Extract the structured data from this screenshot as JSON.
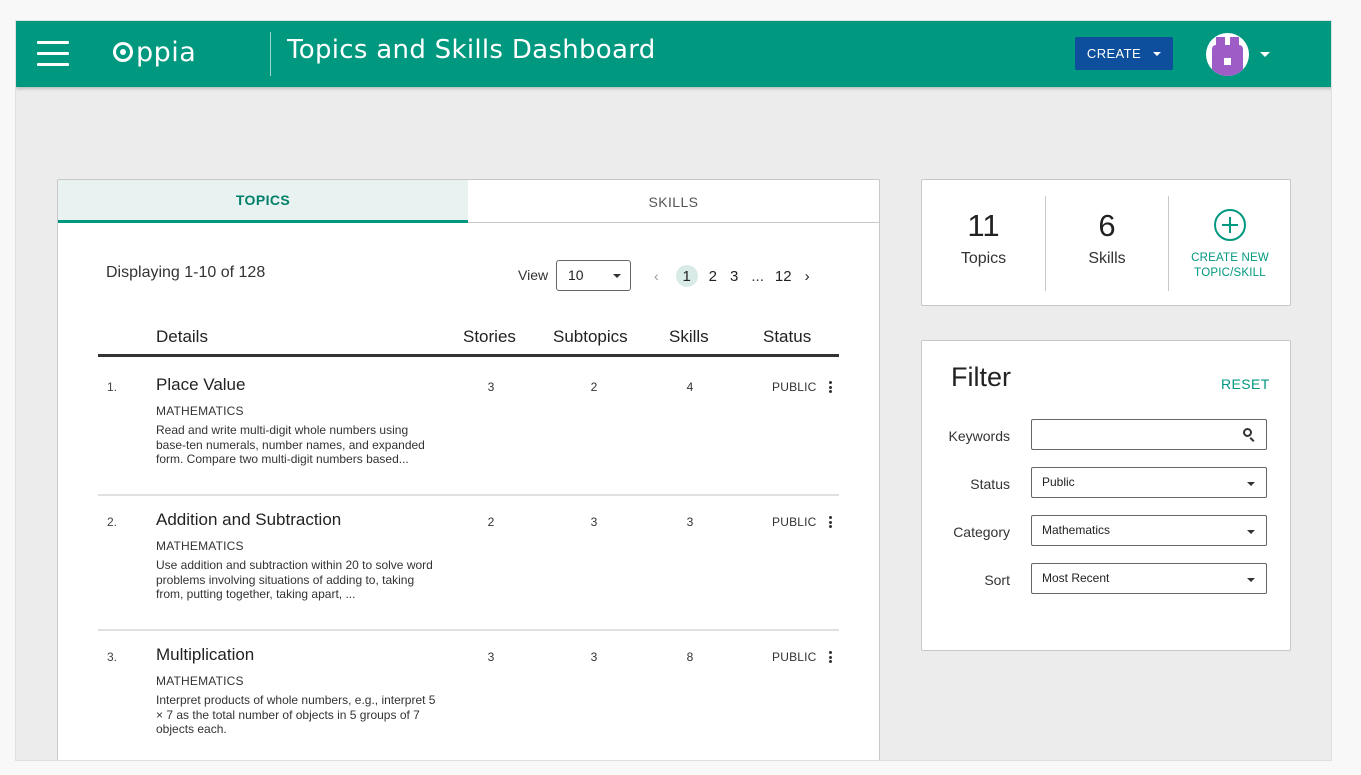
{
  "navbar": {
    "logo_text": "ppia",
    "title": "Topics and Skills Dashboard",
    "create_label": "CREATE",
    "color": "#00987f",
    "create_color": "#0d4f9c"
  },
  "tabs": [
    {
      "label": "TOPICS",
      "active": true
    },
    {
      "label": "SKILLS",
      "active": false
    }
  ],
  "listing": {
    "displaying": "Displaying 1-10 of 128",
    "view_label": "View",
    "view_value": "10",
    "pagination": {
      "prev": "‹",
      "pages": [
        "1",
        "2",
        "3"
      ],
      "ellipsis": "...",
      "last": "12",
      "next": "›",
      "current": "1"
    }
  },
  "table": {
    "headers": {
      "details": "Details",
      "stories": "Stories",
      "subtopics": "Subtopics",
      "skills": "Skills",
      "status": "Status"
    },
    "rows": [
      {
        "num": "1.",
        "name": "Place Value",
        "category": "MATHEMATICS",
        "description": "Read and write multi-digit whole numbers using base-ten numerals, number names, and expanded form. Compare two multi-digit numbers based...",
        "stories": "3",
        "subtopics": "2",
        "skills": "4",
        "status": "PUBLIC"
      },
      {
        "num": "2.",
        "name": "Addition and Subtraction",
        "category": "MATHEMATICS",
        "description": "Use addition and subtraction within 20 to solve word problems involving situations of adding to, taking from, putting together, taking apart, ...",
        "stories": "2",
        "subtopics": "3",
        "skills": "3",
        "status": "PUBLIC"
      },
      {
        "num": "3.",
        "name": "Multiplication",
        "category": "MATHEMATICS",
        "description": "Interpret products of whole numbers, e.g., interpret 5 × 7 as the total number of objects in 5 groups of 7 objects each.",
        "stories": "3",
        "subtopics": "3",
        "skills": "8",
        "status": "PUBLIC"
      }
    ]
  },
  "stats": {
    "topics_count": "11",
    "topics_label": "Topics",
    "skills_count": "6",
    "skills_label": "Skills",
    "create_new_line1": "CREATE NEW",
    "create_new_line2": "TOPIC/SKILL"
  },
  "filter": {
    "title": "Filter",
    "reset_label": "RESET",
    "keywords_label": "Keywords",
    "keywords_value": "",
    "status_label": "Status",
    "status_value": "Public",
    "category_label": "Category",
    "category_value": "Mathematics",
    "sort_label": "Sort",
    "sort_value": "Most Recent"
  }
}
